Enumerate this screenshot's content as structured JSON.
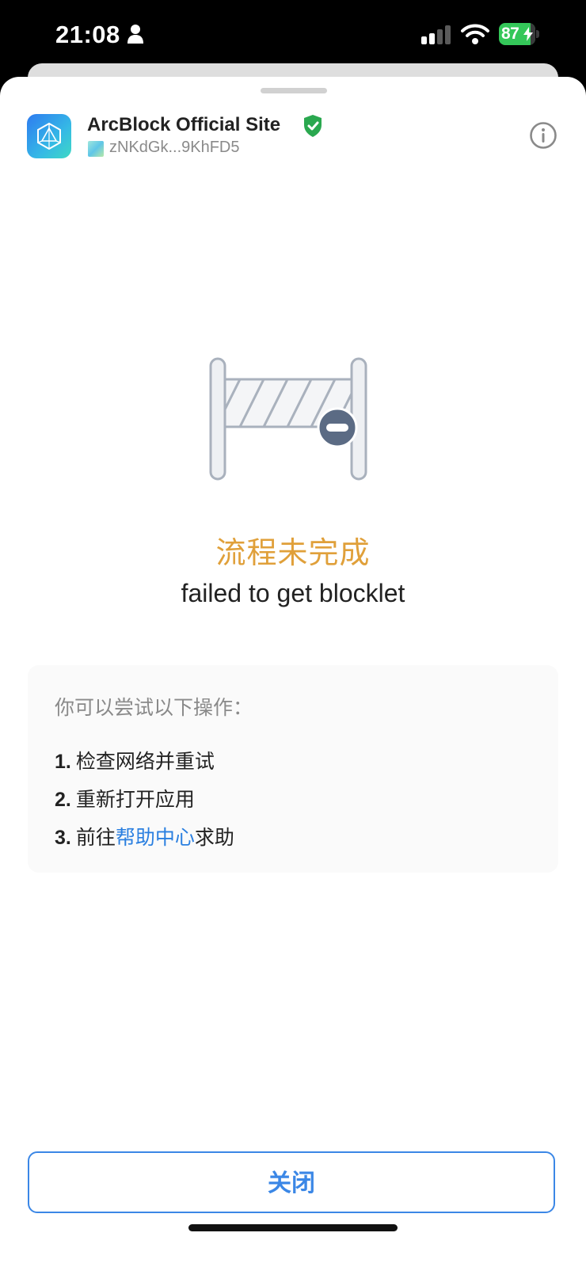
{
  "status_bar": {
    "time": "21:08",
    "battery_percent": 87,
    "battery_label": "87",
    "battery_color": "#34c759",
    "icons": [
      "person-icon",
      "cellular-signal-icon",
      "wifi-icon",
      "battery-charging-icon"
    ]
  },
  "header": {
    "app_title": "ArcBlock Official Site",
    "verified_icon": "shield-check-icon",
    "verified_color": "#2aa84f",
    "did": "zNKdGk...9KhFD5",
    "info_icon": "info-circle-icon"
  },
  "status": {
    "illustration": "barrier-blocked-icon",
    "title": "流程未完成",
    "title_color": "#e0a03a",
    "message": "failed to get blocklet"
  },
  "suggestions": {
    "heading": "你可以尝试以下操作：",
    "items": [
      {
        "number": "1.",
        "text": "检查网络并重试"
      },
      {
        "number": "2.",
        "text": "重新打开应用"
      },
      {
        "number": "3.",
        "prefix": "前往",
        "link": "帮助中心",
        "suffix": "求助"
      }
    ],
    "link_color": "#2a7fe0"
  },
  "footer": {
    "close_label": "关闭",
    "accent": "#3b87e6"
  }
}
